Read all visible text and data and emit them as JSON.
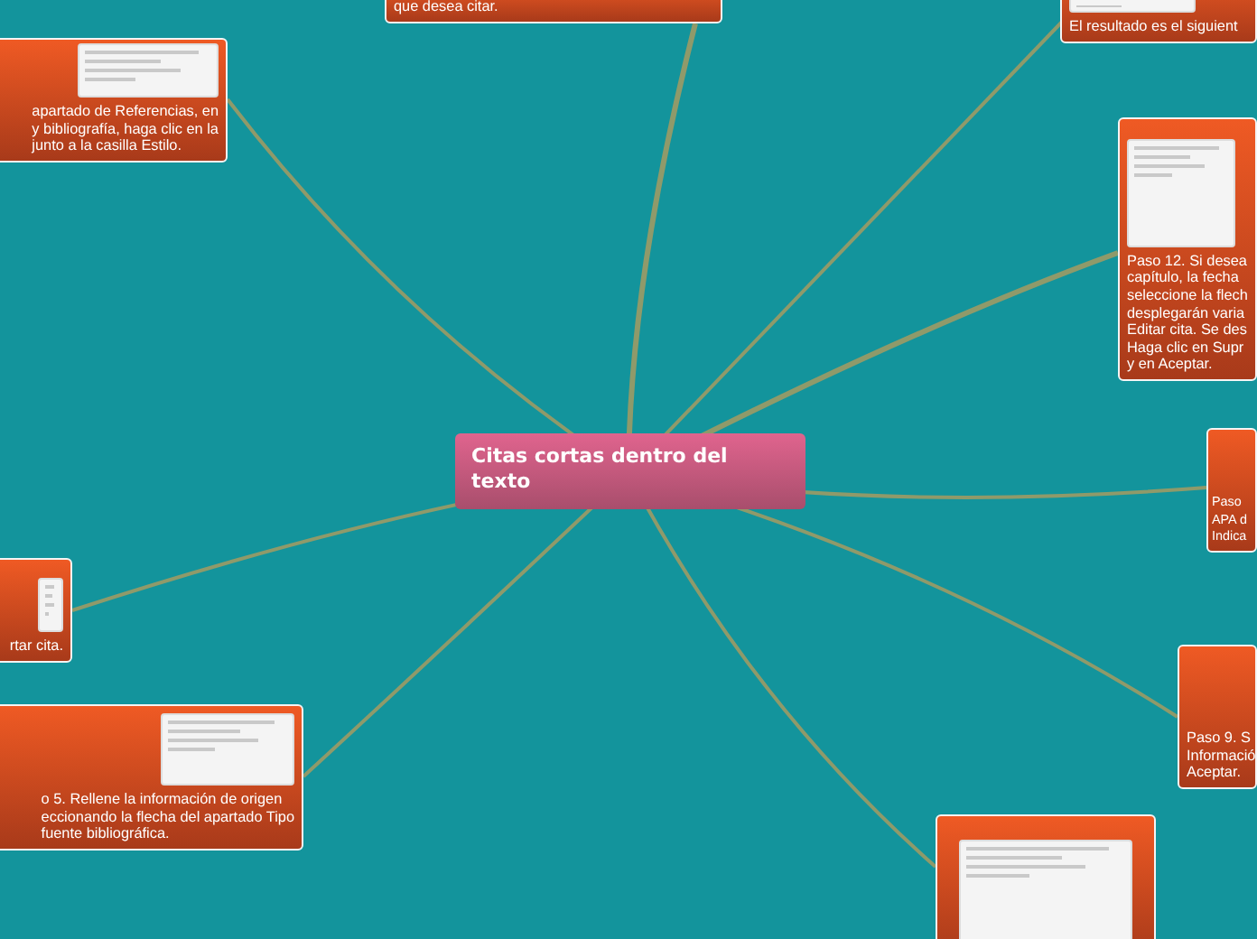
{
  "central_topic": {
    "title": "Citas cortas dentro del texto"
  },
  "steps": [
    {
      "lines": [
        "que desea citar."
      ]
    },
    {
      "lines": [
        "El resultado es el siguient"
      ],
      "image": true
    },
    {
      "lines": [
        "apartado de Referencias, en",
        "y bibliografía, haga clic en la",
        "junto a la casilla Estilo."
      ],
      "image": true
    },
    {
      "lines": [
        "Paso 12. Si desea",
        "capítulo, la fecha",
        "seleccione la flech",
        "desplegarán varia",
        "Editar cita. Se des",
        "Haga clic en Supr",
        "y en Aceptar."
      ],
      "image": true
    },
    {
      "lines": [
        "Paso",
        "APA d",
        "Indica"
      ]
    },
    {
      "lines": [
        "rtar cita."
      ],
      "image": true
    },
    {
      "lines": [
        "o 5. Rellene la información de origen",
        "eccionando la flecha del apartado Tipo",
        "fuente bibliográfica."
      ],
      "image": true
    },
    {
      "lines": [
        "Paso 9. S",
        "Informació",
        "Aceptar."
      ]
    },
    {
      "image": true
    }
  ]
}
